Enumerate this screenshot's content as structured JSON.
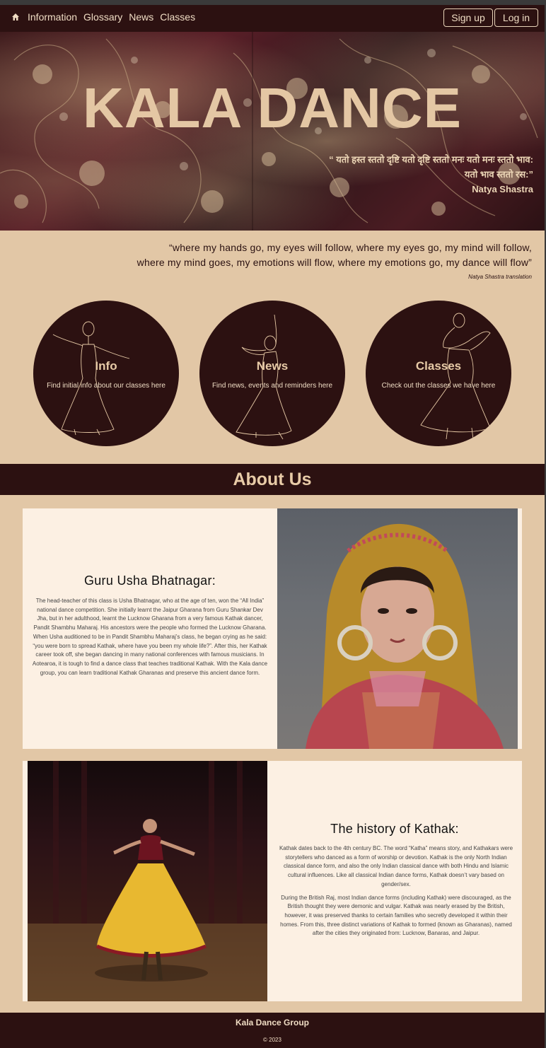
{
  "nav": {
    "links": [
      "Information",
      "Glossary",
      "News",
      "Classes"
    ],
    "signup": "Sign up",
    "login": "Log in"
  },
  "hero": {
    "title": "KALA DANCE",
    "sanskrit_line1": "“ यतो हस्त स्ततो दृष्टि यतो दृष्टि स्ततो मनः यतो मनः स्ततो भाव:",
    "sanskrit_line2": "यतो भाव स्ततो रस:”",
    "sanskrit_source": "Natya Shastra"
  },
  "quote": {
    "line1": "“where my hands go, my eyes will follow, where my eyes go, my mind will follow,",
    "line2": "where my mind goes, my emotions will flow, where my emotions go, my dance will flow”",
    "source": "Natya Shastra translation"
  },
  "circles": [
    {
      "title": "Info",
      "desc": "Find initial info about our classes here"
    },
    {
      "title": "News",
      "desc": "Find news, events and reminders here"
    },
    {
      "title": "Classes",
      "desc": "Check out the classes we have here"
    }
  ],
  "about": {
    "title": "About Us",
    "guru": {
      "heading": "Guru Usha Bhatnagar:",
      "text": "The head-teacher of this class is Usha Bhatnagar, who at the age of ten, won the “All India” national dance competition. She initially learnt the Jaipur Gharana from Guru Shankar Dev Jha, but in her adulthood, learnt the Lucknow Gharana from a very famous Kathak dancer, Pandit Shambhu Maharaj. His ancestors were the people who formed the Lucknow Gharana. When Usha auditioned to be in Pandit Shambhu Maharaj’s class, he began crying as he said: “you were born to spread Kathak, where have you been my whole life?”. After this, her Kathak career took off, she began dancing in many national conferences with famous musicians. In Aotearoa, it is tough to find a dance class that teaches traditional Kathak. With the Kala dance group, you can learn traditional Kathak Gharanas and preserve this ancient dance form."
    },
    "history": {
      "heading": "The history of Kathak:",
      "para1": "Kathak dates back to the 4th century BC. The word “Katha” means story, and Kathakars were storytellers who danced as a form of worship or devotion. Kathak is the only North Indian classical dance form, and also the only Indian classical dance with both Hindu and Islamic cultural influences. Like all classical Indian dance forms, Kathak doesn’t vary based on gender/sex.",
      "para2": "During the British Raj, most Indian dance forms (including Kathak) were discouraged, as the British thought they were demonic and vulgar. Kathak was nearly erased by the British, however, it was preserved thanks to certain families who secretly developed it within their homes. From this, three distinct variations of Kathak to formed (known as Gharanas), named after the cities they originated from: Lucknow, Banaras, and Jaipur."
    }
  },
  "footer": {
    "title": "Kala Dance Group",
    "copy": "© 2023"
  }
}
